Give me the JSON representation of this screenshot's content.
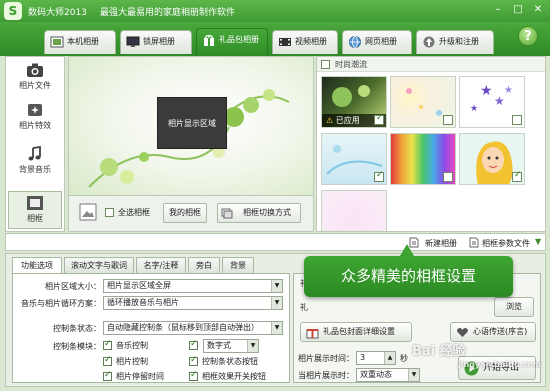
{
  "app": {
    "logo_text": "S",
    "title": "数码大师2013",
    "subtitle": "最强大最易用的家庭相册制作软件"
  },
  "tabs": [
    {
      "label": "本机相册",
      "icon": "photo-album-icon"
    },
    {
      "label": "锁屏相册",
      "icon": "monitor-icon"
    },
    {
      "label": "礼品包相册",
      "icon": "gift-icon",
      "active": true
    },
    {
      "label": "视频相册",
      "icon": "film-icon"
    },
    {
      "label": "网页相册",
      "icon": "globe-icon"
    },
    {
      "label": "升级和注册",
      "icon": "upgrade-icon"
    }
  ],
  "help_label": "?",
  "sidebar": {
    "items": [
      {
        "label": "相片文件",
        "icon": "camera-icon"
      },
      {
        "label": "相片特效",
        "icon": "sparkle-icon"
      },
      {
        "label": "背景音乐",
        "icon": "music-note-icon"
      },
      {
        "label": "相框",
        "icon": "frame-icon",
        "active": true
      }
    ]
  },
  "preview": {
    "photo_area_label": "相片显示区域",
    "select_all_label": "全选相框",
    "my_frames_label": "我的相框",
    "switch_mode_label": "相框切换方式"
  },
  "gallery": {
    "header_label": "时尚潮流",
    "applied_label": "已应用"
  },
  "midbar": {
    "new_frame_label": "新建相册",
    "frame_params_label": "相框参数文件"
  },
  "bottom_tabs": [
    {
      "label": "功能选项",
      "active": true
    },
    {
      "label": "滚动文字与歌词"
    },
    {
      "label": "名字/注释"
    },
    {
      "label": "旁白"
    },
    {
      "label": "背景"
    }
  ],
  "settings": {
    "photo_size_label": "相片区域大小：",
    "photo_size_value": "相片显示区域全屏",
    "loop_label": "音乐与相片循环方案：",
    "loop_value": "循环播放音乐与相片",
    "control_label": "控制条状态：",
    "control_value": "自动隐藏控制条（鼠标移到顶部自动弹出）",
    "modules_label": "控制条模块：",
    "music_control": "音乐控制",
    "digital_mode_value": "数字式",
    "photo_control": "相片控制",
    "control_status_btn": "控制条状态按钮",
    "photo_pause_time": "相片停留时间",
    "frame_effect_btn": "相框效果开关按钮"
  },
  "rightpanel": {
    "tab_partial": "礼",
    "text_partial": "礼",
    "preview_suffix": "浏览",
    "gift_detail_label": "礼品包封面详细设置",
    "greeting_label": "心语传送(序言)",
    "display_time_label": "相片展示时间：",
    "display_time_value": "3",
    "display_time_unit": "秒",
    "current_display_label": "当相片展示时：",
    "current_display_value": "双重动态",
    "export_label": "开始导出"
  },
  "callout": {
    "text": "众多精美的相框设置"
  },
  "watermark": {
    "text": "Bai 经验",
    "url": "jingyan.baidu.com"
  },
  "colors": {
    "accent": "#3f9a33",
    "accent_dark": "#2e8c25",
    "panel_bg": "#e7eee3"
  }
}
